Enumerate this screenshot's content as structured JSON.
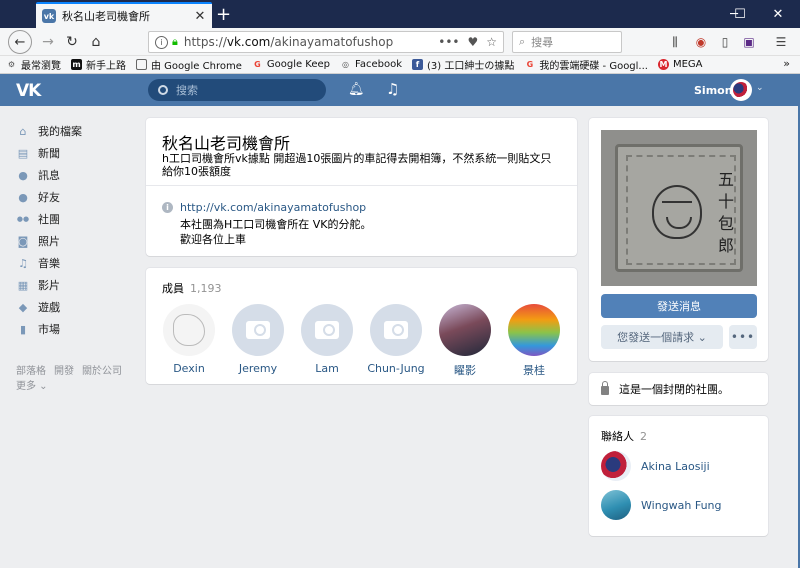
{
  "browser": {
    "tab_title": "秋名山老司機會所",
    "tab_favicon": "vk-favicon",
    "url_prefix": "https://",
    "url_main": "vk.com",
    "url_path": "/akinayamatofushop",
    "search_placeholder": "搜尋",
    "page_actions": "•••"
  },
  "bookmarks": [
    {
      "label": "最常瀏覽",
      "icon": "gear-icon",
      "color": "#555555"
    },
    {
      "label": "新手上路",
      "icon": "m-icon",
      "color": "#111111"
    },
    {
      "label": "由 Google Chrome",
      "icon": "folder-icon",
      "color": "#666666"
    },
    {
      "label": "Google Keep",
      "icon": "google-icon",
      "color": "#ea4335"
    },
    {
      "label": "Facebook",
      "icon": "globe-icon",
      "color": "#555555"
    },
    {
      "label": "(3) 工口紳士の據點",
      "icon": "facebook-icon",
      "color": "#3b5998"
    },
    {
      "label": "我的雲端硬碟 - Googl...",
      "icon": "google-icon",
      "color": "#ea4335"
    },
    {
      "label": "MEGA",
      "icon": "mega-icon",
      "color": "#d9272e"
    }
  ],
  "vk": {
    "logo": "VK",
    "search_placeholder": "搜索",
    "user_name": "Simon",
    "accent": "#4a76a8"
  },
  "sidebar": {
    "items": [
      {
        "label": "我的檔案",
        "icon": "home-icon",
        "glyph": "⌂"
      },
      {
        "label": "新聞",
        "icon": "news-icon",
        "glyph": "▤"
      },
      {
        "label": "訊息",
        "icon": "message-icon",
        "glyph": "●"
      },
      {
        "label": "好友",
        "icon": "friend-icon",
        "glyph": "●"
      },
      {
        "label": "社團",
        "icon": "group-icon",
        "glyph": "●●"
      },
      {
        "label": "照片",
        "icon": "camera-icon",
        "glyph": "◙"
      },
      {
        "label": "音樂",
        "icon": "music-icon",
        "glyph": "♫"
      },
      {
        "label": "影片",
        "icon": "video-icon",
        "glyph": "▦"
      },
      {
        "label": "遊戲",
        "icon": "gamepad-icon",
        "glyph": "◆"
      },
      {
        "label": "市場",
        "icon": "market-icon",
        "glyph": "▮"
      }
    ],
    "footer": [
      "部落格",
      "開發",
      "關於公司"
    ],
    "footer_more": "更多 ⌄"
  },
  "group": {
    "title": "秋名山老司機會所",
    "status": "h工口司機會所vk據點 開超過10張圖片的車記得去開相簿，不然系統一則貼文只給你10張額度",
    "link": "http://vk.com/akinayamatofushop",
    "description_line1": "本社團為H工口司機會所在 VK的分舵。",
    "description_line2": "歡迎各位上車"
  },
  "members": {
    "label": "成員",
    "count": "1,193",
    "list": [
      {
        "name": "Dexin",
        "avatar": "sketch"
      },
      {
        "name": "Jeremy",
        "avatar": "camera"
      },
      {
        "name": "Lam",
        "avatar": "camera"
      },
      {
        "name": "Chun-Jung",
        "avatar": "camera"
      },
      {
        "name": "矅影",
        "avatar": "anime"
      },
      {
        "name": "景桂",
        "avatar": "rainbow"
      }
    ]
  },
  "side": {
    "photo_text": "五十包郎",
    "send_message": "發送消息",
    "request_sent": "您發送一個請求 ⌄",
    "more": "•••",
    "closed_notice": "這是一個封閉的社團。",
    "contacts_label": "聯絡人",
    "contacts_count": "2",
    "contacts": [
      {
        "name": "Akina Laosiji",
        "avatar": "flag"
      },
      {
        "name": "Wingwah Fung",
        "avatar": "fish"
      }
    ]
  }
}
